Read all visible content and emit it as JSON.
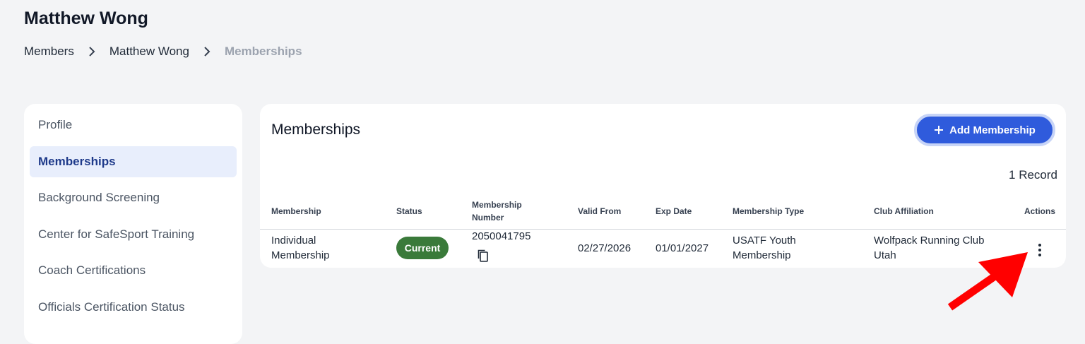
{
  "page": {
    "title": "Matthew Wong"
  },
  "breadcrumb": {
    "items": [
      "Members",
      "Matthew Wong",
      "Memberships"
    ]
  },
  "sidebar": {
    "items": [
      {
        "label": "Profile",
        "active": false
      },
      {
        "label": "Memberships",
        "active": true
      },
      {
        "label": "Background Screening",
        "active": false
      },
      {
        "label": "Center for SafeSport Training",
        "active": false
      },
      {
        "label": "Coach Certifications",
        "active": false
      },
      {
        "label": "Officials Certification Status",
        "active": false
      }
    ]
  },
  "main": {
    "title": "Memberships",
    "add_button_label": "Add Membership",
    "record_count": "1 Record",
    "table": {
      "columns": [
        "Membership",
        "Status",
        "Membership Number",
        "Valid From",
        "Exp Date",
        "Membership Type",
        "Club Affiliation",
        "Actions"
      ],
      "rows": [
        {
          "membership": "Individual Membership",
          "status": "Current",
          "membership_number": "2050041795",
          "valid_from": "02/27/2026",
          "exp_date": "01/01/2027",
          "membership_type": "USATF Youth Membership",
          "club_affiliation": "Wolfpack Running Club Utah"
        }
      ]
    }
  },
  "colors": {
    "primary": "#2f5bdc",
    "status_current": "#3a7a3a",
    "annotation_arrow": "#ff0000",
    "active_nav_bg": "#e8eefc"
  },
  "icons": {
    "breadcrumb_separator": "chevron-right-icon",
    "add": "plus-icon",
    "copy": "copy-icon",
    "actions": "more-vertical-icon",
    "annotation": "red-arrow-annotation"
  }
}
